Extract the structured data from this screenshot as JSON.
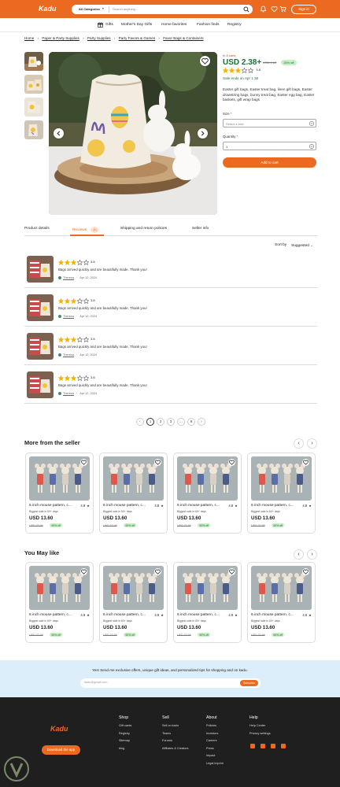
{
  "header": {
    "logo": "Kadu",
    "category": "All Categories",
    "search_placeholder": "Search anything...",
    "signin": "Sign in"
  },
  "nav": {
    "items": [
      "Gifts",
      "Mother's Day Gifts",
      "Home favorites",
      "Fashion finds",
      "Registry"
    ]
  },
  "breadcrumb": [
    "Home",
    "Paper & Party Supplies",
    "Party Supplies",
    "Party Favors & Games",
    "Favor Bags & Containers"
  ],
  "product": {
    "stock_note": "In 8 carts",
    "price": "USD 2.38+",
    "old_price": "USD 2.80",
    "off": "15% off",
    "rating": 3,
    "rating_value": "3.8",
    "sale_msg": "Sale ends on Apr 1 30",
    "description": "Easter gift bags, Easter treat bag, linen gift bags, Easter drawstring bags, bunny treat bag, Easter egg bag, Easter baskets, gift wrap bags",
    "size_label": "Size",
    "size_placeholder": "Select a size",
    "qty_label": "Quantity",
    "qty_value": "1",
    "add_to_cart": "Add to cart"
  },
  "tabs": {
    "details": "Product details",
    "reviews": "Reviews",
    "reviews_count": "(4)",
    "shipping": "Shipping and return policies",
    "seller": "Seller info"
  },
  "sort": {
    "label": "Sort by",
    "value": "Suggested"
  },
  "reviews": [
    {
      "rating": "3.8",
      "text": "Bags arrived quickly and are beautifully made. Thank you!",
      "author": "Theresa",
      "date": "Apr 12, 2024"
    },
    {
      "rating": "3.8",
      "text": "Bags arrived quickly and are beautifully made. Thank you!",
      "author": "Theresa",
      "date": "Apr 12, 2024"
    },
    {
      "rating": "3.8",
      "text": "Bags arrived quickly and are beautifully made. Thank you!",
      "author": "Theresa",
      "date": "Apr 12, 2024"
    },
    {
      "rating": "3.8",
      "text": "Bags arrived quickly and are beautifully made. Thank you!",
      "author": "Theresa",
      "date": "Apr 12, 2024"
    }
  ],
  "pagination": [
    "‹",
    "1",
    "2",
    "3",
    "...",
    "9",
    "›"
  ],
  "more_from_seller": {
    "title": "More from the seller",
    "cards": [
      {
        "title": "6 inch mouse pattern, c...",
        "rating": "4.8",
        "sub": "Biggest sale in 60+ days",
        "price": "USD 13.60",
        "old": "USD 33.99",
        "off": "60% off"
      },
      {
        "title": "6 inch mouse pattern, c...",
        "rating": "4.8",
        "sub": "Biggest sale in 60+ days",
        "price": "USD 13.60",
        "old": "USD 33.99",
        "off": "60% off"
      },
      {
        "title": "6 inch mouse pattern, c...",
        "rating": "4.8",
        "sub": "Biggest sale in 60+ days",
        "price": "USD 13.60",
        "old": "USD 33.99",
        "off": "60% off"
      },
      {
        "title": "6 inch mouse pattern, c...",
        "rating": "4.8",
        "sub": "Biggest sale in 60+ days",
        "price": "USD 13.60",
        "old": "USD 33.99",
        "off": "60% off"
      }
    ]
  },
  "you_may_like": {
    "title": "You May like",
    "cards": [
      {
        "title": "6 inch mouse pattern, c...",
        "rating": "4.9",
        "sub": "Biggest sale in 60+ days",
        "price": "USD 13.60",
        "old": "USD 33.99",
        "off": "60% off"
      },
      {
        "title": "6 inch mouse pattern, c...",
        "rating": "4.9",
        "sub": "Biggest sale in 60+ days",
        "price": "USD 13.60",
        "old": "USD 33.99",
        "off": "60% off"
      },
      {
        "title": "6 inch mouse pattern, c...",
        "rating": "4.9",
        "sub": "Biggest sale in 60+ days",
        "price": "USD 13.60",
        "old": "USD 33.99",
        "off": "60% off"
      },
      {
        "title": "6 inch mouse pattern, c...",
        "rating": "4.6",
        "sub": "Biggest sale in 60+ days",
        "price": "USD 13.60",
        "old": "USD 33.99",
        "off": "60% off"
      }
    ]
  },
  "newsletter": {
    "text": "Yes! Send me exclusive offers, unique gift ideas, and personalized tips for shopping and on kadu.",
    "placeholder": "kadu@gmail.com",
    "button": "Subscribe"
  },
  "footer": {
    "logo": "Kadu",
    "download": "Download the app",
    "columns": [
      {
        "title": "Shop",
        "links": [
          "Gift cards",
          "Registry",
          "Sitemap",
          "blog"
        ]
      },
      {
        "title": "Sell",
        "links": [
          "Sell on kadu",
          "Teams",
          "Forums",
          "Affiliates & Creators"
        ]
      },
      {
        "title": "About",
        "links": [
          "Policies",
          "Investors",
          "Careers",
          "Press",
          "Impact",
          "Legal imprint"
        ]
      },
      {
        "title": "Help",
        "links": [
          "Help Center",
          "Privacy settings"
        ]
      }
    ]
  },
  "colors": {
    "accent": "#ec6a20",
    "green": "#1c6e36",
    "star": "#f5b301"
  }
}
